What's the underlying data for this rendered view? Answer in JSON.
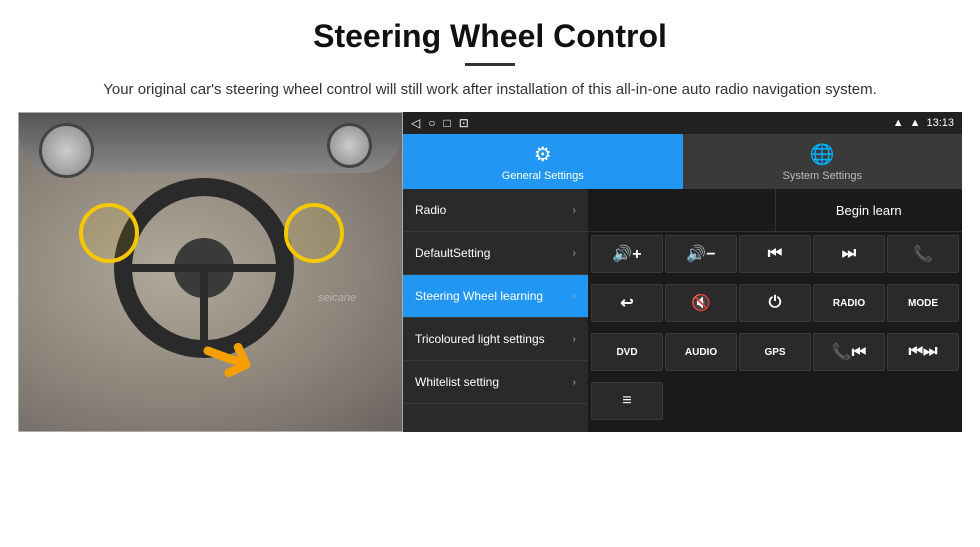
{
  "header": {
    "title": "Steering Wheel Control",
    "subtitle": "Your original car's steering wheel control will still work after installation of this all-in-one auto radio navigation system."
  },
  "android": {
    "status_bar": {
      "back_icon": "◁",
      "home_icon": "○",
      "square_icon": "□",
      "cast_icon": "⊡",
      "signal_icon": "▲",
      "wifi_icon": "▲",
      "time": "13:13"
    },
    "tabs": [
      {
        "label": "General Settings",
        "active": true
      },
      {
        "label": "System Settings",
        "active": false
      }
    ],
    "menu": [
      {
        "label": "Radio",
        "chevron": true,
        "active": false
      },
      {
        "label": "DefaultSetting",
        "chevron": true,
        "active": false
      },
      {
        "label": "Steering Wheel learning",
        "chevron": true,
        "active": true
      },
      {
        "label": "Tricoloured light settings",
        "chevron": true,
        "active": false
      },
      {
        "label": "Whitelist setting",
        "chevron": true,
        "active": false
      }
    ],
    "begin_learn_label": "Begin learn",
    "controls": [
      {
        "icon": "🔊+",
        "type": "icon"
      },
      {
        "icon": "🔊−",
        "type": "icon"
      },
      {
        "icon": "⏮",
        "type": "icon"
      },
      {
        "icon": "⏭",
        "type": "icon"
      },
      {
        "icon": "📞",
        "type": "icon"
      },
      {
        "icon": "↩",
        "type": "icon"
      },
      {
        "icon": "🔇",
        "type": "icon"
      },
      {
        "icon": "⏻",
        "type": "icon"
      },
      {
        "text": "RADIO",
        "type": "text"
      },
      {
        "text": "MODE",
        "type": "text"
      },
      {
        "text": "DVD",
        "type": "text"
      },
      {
        "text": "AUDIO",
        "type": "text"
      },
      {
        "text": "GPS",
        "type": "text"
      },
      {
        "icon": "📞⏮",
        "type": "icon"
      },
      {
        "icon": "⏮⏭",
        "type": "icon"
      },
      {
        "icon": "≡",
        "type": "icon"
      }
    ]
  }
}
